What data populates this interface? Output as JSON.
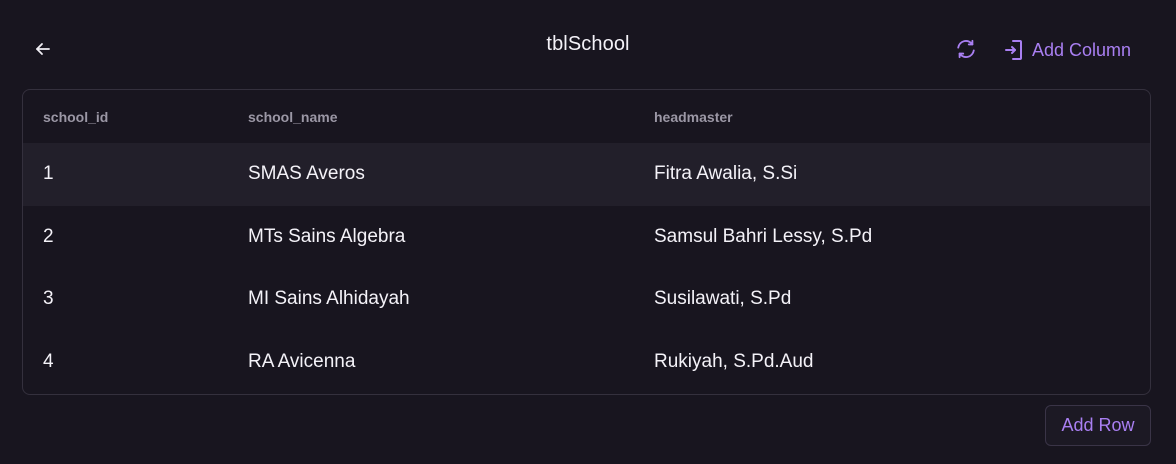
{
  "header": {
    "title": "tblSchool",
    "add_column_label": "Add Column"
  },
  "table": {
    "columns": [
      "school_id",
      "school_name",
      "headmaster"
    ],
    "rows": [
      [
        "1",
        "SMAS Averos",
        "Fitra Awalia, S.Si"
      ],
      [
        "2",
        "MTs Sains Algebra",
        "Samsul Bahri Lessy, S.Pd"
      ],
      [
        "3",
        "MI Sains Alhidayah",
        "Susilawati, S.Pd"
      ],
      [
        "4",
        "RA Avicenna",
        "Rukiyah, S.Pd.Aud"
      ]
    ]
  },
  "footer": {
    "add_row_label": "Add Row"
  },
  "icons": {
    "back": "arrow-left-icon",
    "refresh": "refresh-icon",
    "add_column": "add-column-icon"
  },
  "colors": {
    "accent": "#a97ff2",
    "background": "#18151f",
    "highlight_row": "#221f2a"
  }
}
